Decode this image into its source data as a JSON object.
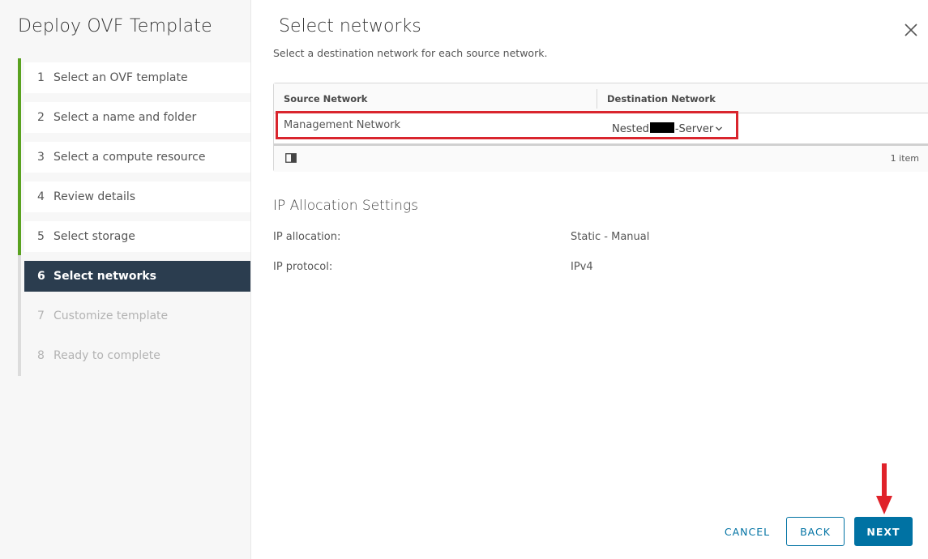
{
  "wizard": {
    "title": "Deploy OVF Template",
    "steps": [
      {
        "number": "1",
        "label": "Select an OVF template",
        "state": "done"
      },
      {
        "number": "2",
        "label": "Select a name and folder",
        "state": "done"
      },
      {
        "number": "3",
        "label": "Select a compute resource",
        "state": "done"
      },
      {
        "number": "4",
        "label": "Review details",
        "state": "done"
      },
      {
        "number": "5",
        "label": "Select storage",
        "state": "done"
      },
      {
        "number": "6",
        "label": "Select networks",
        "state": "active"
      },
      {
        "number": "7",
        "label": "Customize template",
        "state": "pending"
      },
      {
        "number": "8",
        "label": "Ready to complete",
        "state": "pending"
      }
    ]
  },
  "page": {
    "title": "Select networks",
    "subtitle": "Select a destination network for each source network.",
    "close_icon": "close-icon"
  },
  "network_grid": {
    "columns": [
      "Source Network",
      "Destination Network"
    ],
    "rows": [
      {
        "source": "Management Network",
        "destination_prefix": "Nested",
        "destination_suffix": "-Server"
      }
    ],
    "footer_count": "1 item",
    "column_toggle_icon": "column-toggle-icon"
  },
  "ip_allocation": {
    "title": "IP Allocation Settings",
    "rows": [
      {
        "label": "IP allocation:",
        "value": "Static - Manual"
      },
      {
        "label": "IP protocol:",
        "value": "IPv4"
      }
    ]
  },
  "buttons": {
    "cancel": "CANCEL",
    "back": "BACK",
    "next": "NEXT"
  },
  "colors": {
    "accent": "#0072a3",
    "done_rail": "#5aa220",
    "active_step_bg": "#2b3d4f",
    "annotation_red": "#d9252d"
  }
}
